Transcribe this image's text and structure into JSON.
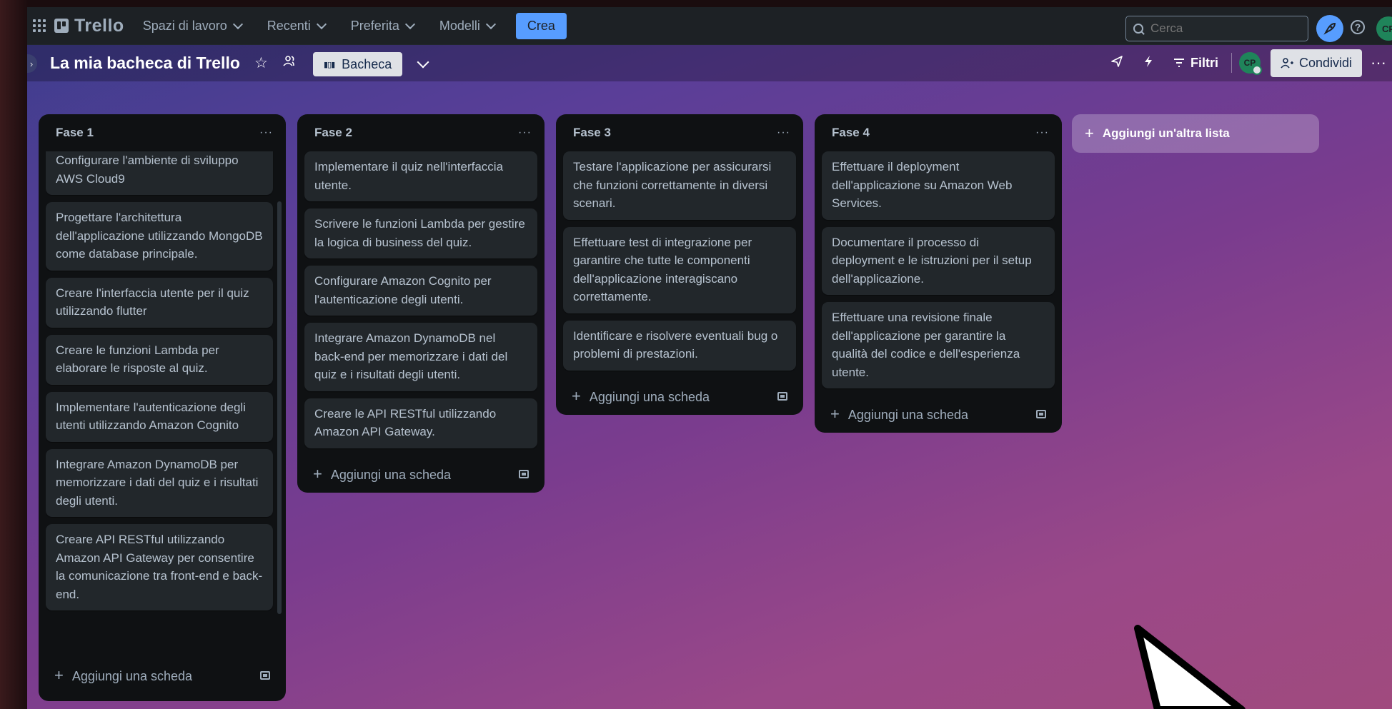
{
  "nav": {
    "logo": "Trello",
    "menus": [
      "Spazi di lavoro",
      "Recenti",
      "Preferita",
      "Modelli"
    ],
    "create": "Crea",
    "search_placeholder": "Cerca",
    "avatar": "CP"
  },
  "board": {
    "title": "La mia bacheca di Trello",
    "view": "Bacheca",
    "filters": "Filtri",
    "avatar": "CP",
    "share": "Condividi",
    "more": "···"
  },
  "lists": [
    {
      "title": "Fase 1",
      "cards": [
        "Configurare l'ambiente di sviluppo AWS Cloud9",
        "Progettare l'architettura dell'applicazione utilizzando MongoDB come database principale.",
        "Creare l'interfaccia utente per il quiz utilizzando flutter",
        "Creare le funzioni Lambda per elaborare le risposte al quiz.",
        "Implementare l'autenticazione degli utenti utilizzando Amazon Cognito",
        "Integrare Amazon DynamoDB per memorizzare i dati del quiz e i risultati degli utenti.",
        "Creare API RESTful utilizzando Amazon API Gateway per consentire la comunicazione tra front-end e back-end."
      ]
    },
    {
      "title": "Fase 2",
      "cards": [
        "Implementare il quiz nell'interfaccia utente.",
        "Scrivere le funzioni Lambda per gestire la logica di business del quiz.",
        "Configurare Amazon Cognito per l'autenticazione degli utenti.",
        "Integrare Amazon DynamoDB nel back-end per memorizzare i dati del quiz e i risultati degli utenti.",
        "Creare le API RESTful utilizzando Amazon API Gateway."
      ]
    },
    {
      "title": "Fase 3",
      "cards": [
        "Testare l'applicazione per assicurarsi che funzioni correttamente in diversi scenari.",
        "Effettuare test di integrazione per garantire che tutte le componenti dell'applicazione interagiscano correttamente.",
        "Identificare e risolvere eventuali bug o problemi di prestazioni."
      ]
    },
    {
      "title": "Fase 4",
      "cards": [
        "Effettuare il deployment dell'applicazione su Amazon Web Services.",
        "Documentare il processo di deployment e le istruzioni per il setup dell'applicazione.",
        "Effettuare una revisione finale dell'applicazione per garantire la qualità del codice e dell'esperienza utente."
      ]
    }
  ],
  "list_more": "···",
  "add_card": "Aggiungi una scheda",
  "add_list": "Aggiungi un'altra lista"
}
